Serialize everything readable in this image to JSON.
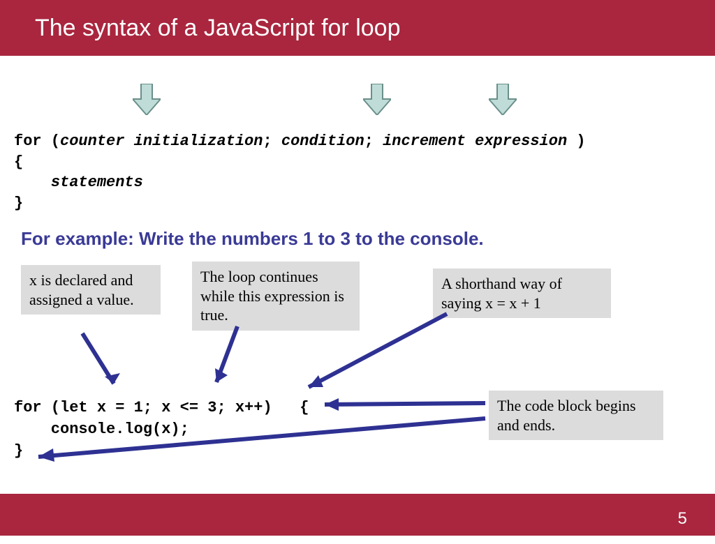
{
  "header": {
    "title": "The syntax of a JavaScript for loop"
  },
  "syntax": {
    "for": "for (",
    "counter_init": "counter initialization",
    "sep1": "; ",
    "condition": "condition",
    "sep2": "; ",
    "increment": "increment expression",
    "close_paren": " )",
    "open_brace": "{",
    "statements_indent": "    ",
    "statements": "statements",
    "close_brace": "}"
  },
  "example_heading": "For example: Write the numbers 1 to 3 to the console.",
  "notes": {
    "declared": "x is declared and assigned a value.",
    "continues": "The loop continues while this expression is true.",
    "shorthand": "A shorthand way of saying x = x + 1",
    "block": "The code block begins and ends."
  },
  "code": {
    "line1": "for (let x = 1; x <= 3; x++)   {",
    "line2": "    console.log(x);",
    "line3": "}"
  },
  "footer": {
    "page": "5"
  }
}
